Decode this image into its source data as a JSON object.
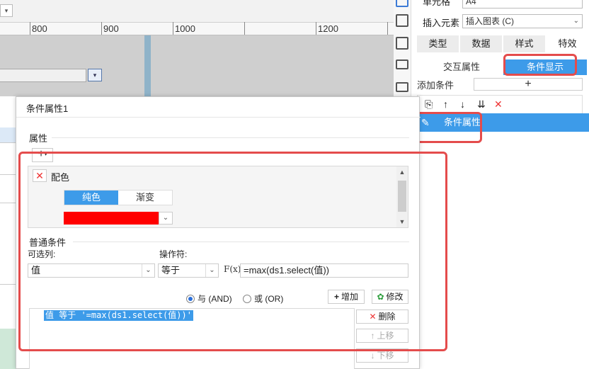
{
  "ruler": {
    "labels": [
      "800",
      "900",
      "1000",
      "1200"
    ]
  },
  "right_panel": {
    "cell_label": "单元格",
    "cell_value": "A4",
    "insert_label": "插入元素",
    "insert_value": "插入图表 (C)",
    "tabs": [
      "类型",
      "数据",
      "样式",
      "特效"
    ],
    "subtabs": [
      "交互属性",
      "条件显示"
    ],
    "add_condition_label": "添加条件",
    "add_condition_plus": "+",
    "condition_item": "条件属性"
  },
  "dialog": {
    "title": "条件属性1",
    "attr_section": "属性",
    "add_button": "+",
    "property": {
      "name": "配色",
      "seg_options": [
        "纯色",
        "渐变"
      ],
      "selected_color": "#ff0000"
    },
    "common_section": "普通条件",
    "column_label": "可选列:",
    "column_value": "值",
    "operator_label": "操作符:",
    "operator_value": "等于",
    "fx_label": "F(x)",
    "formula_value": "=max(ds1.select(值))",
    "radio_and": "与 (AND)",
    "radio_or": "或 (OR)",
    "add_cond_btn": "增加",
    "modify_btn": "修改",
    "delete_btn": "删除",
    "move_up_btn": "上移",
    "move_down_btn": "下移",
    "condition_list": [
      "值 等于 '=max(ds1.select(值))'"
    ]
  }
}
